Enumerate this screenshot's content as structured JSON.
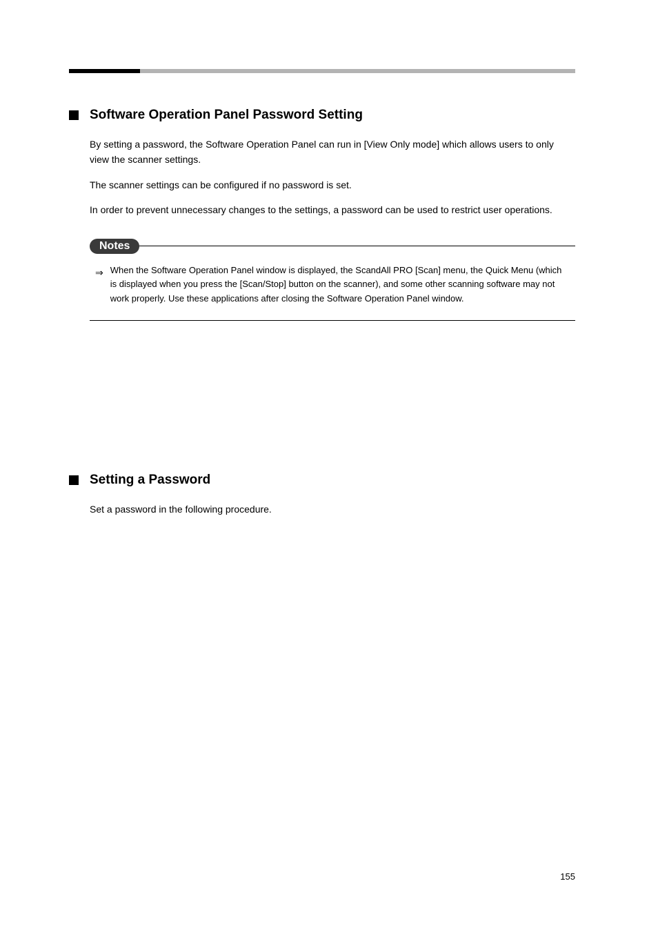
{
  "sections": [
    {
      "title": "Software Operation Panel Password Setting",
      "paragraphs": [
        "By setting a password, the Software Operation Panel can run in [View Only mode] which allows users to only view the scanner settings.",
        "The scanner settings can be configured if no password is set.",
        "In order to prevent unnecessary changes to the settings, a password can be used to restrict user operations."
      ]
    },
    {
      "title": "Setting a Password",
      "paragraphs": [
        "Set a password in the following procedure."
      ]
    }
  ],
  "notes": {
    "label": "Notes",
    "text": "When the Software Operation Panel window is displayed, the ScandAll PRO [Scan] menu, the Quick Menu (which is displayed when you press the [Scan/Stop] button on the scanner), and some other scanning software may not work properly. Use these applications after closing the Software Operation Panel window."
  },
  "pageNumber": "155"
}
